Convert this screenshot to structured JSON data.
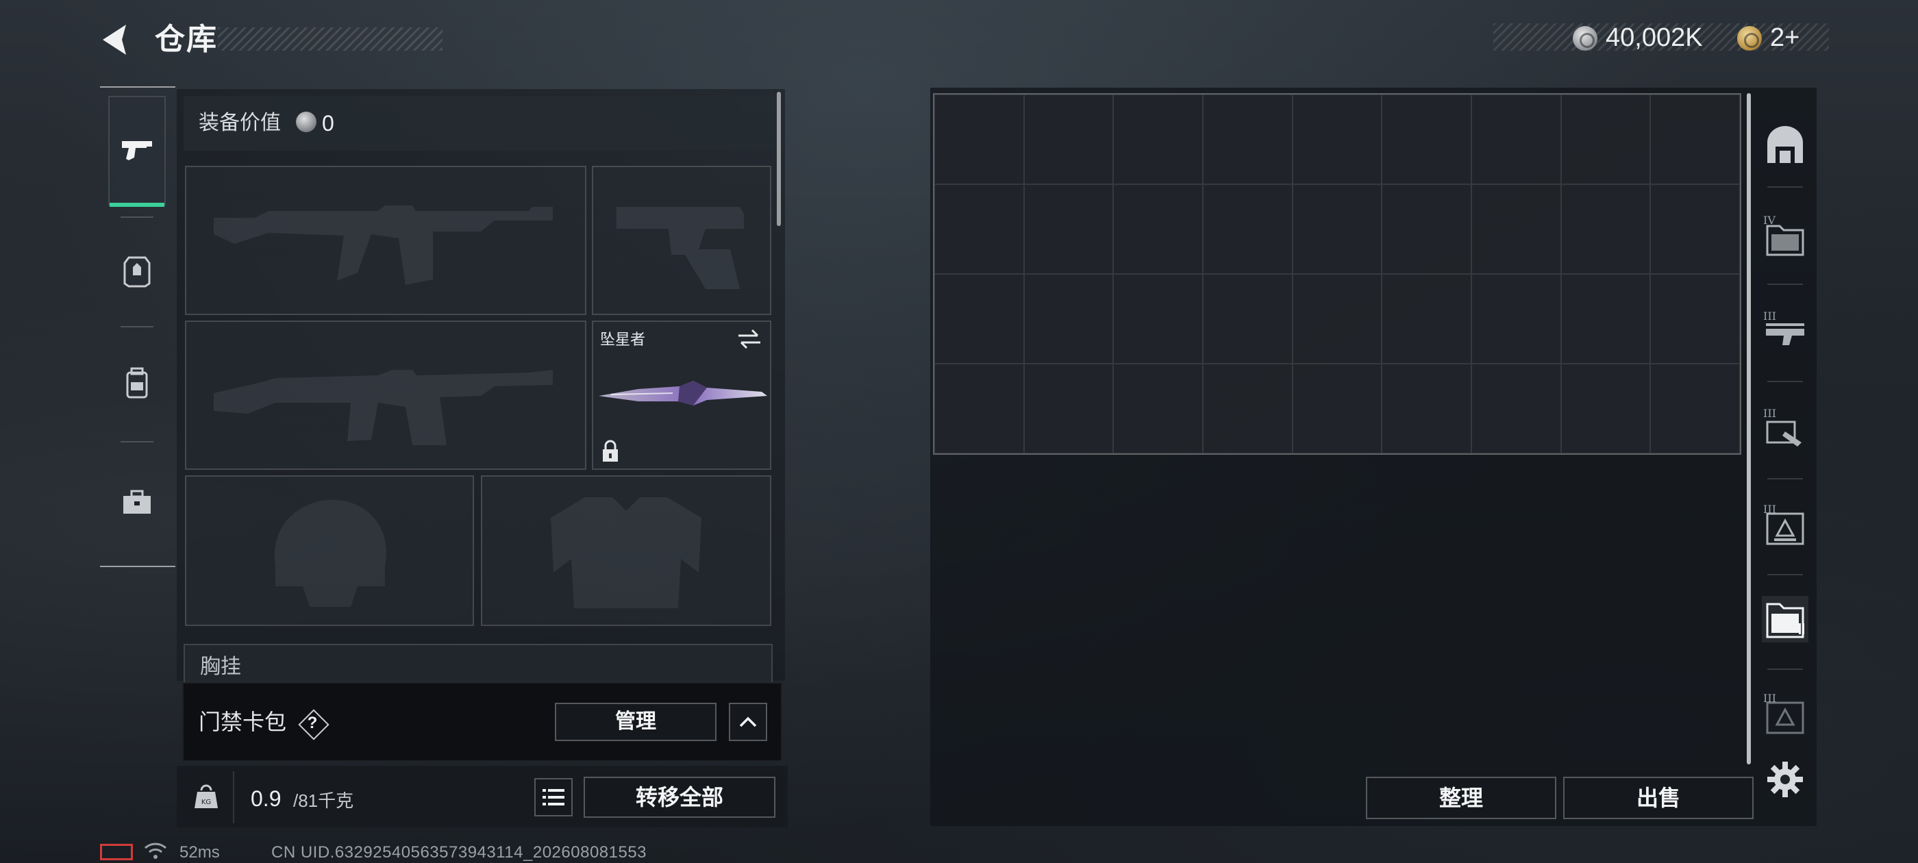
{
  "header": {
    "title": "仓库",
    "currencies": [
      {
        "icon": "silver-coin-icon",
        "value": "40,002K"
      },
      {
        "icon": "gold-coin-icon",
        "value": "2+"
      }
    ]
  },
  "left_rail": {
    "tabs": [
      {
        "icon": "pistol-icon",
        "active": true
      },
      {
        "icon": "armor-icon",
        "active": false
      },
      {
        "icon": "backpack-icon",
        "active": false
      },
      {
        "icon": "toolbox-icon",
        "active": false
      }
    ]
  },
  "loadout": {
    "value_label": "装备价值",
    "value": "0",
    "slots": [
      {
        "kind": "primary-weapon-1",
        "name": "",
        "empty": true
      },
      {
        "kind": "pistol",
        "name": "",
        "empty": true
      },
      {
        "kind": "primary-weapon-2",
        "name": "",
        "empty": true
      },
      {
        "kind": "melee",
        "name": "坠星者",
        "empty": false,
        "locked": true,
        "swappable": true
      },
      {
        "kind": "helmet",
        "name": "",
        "empty": true
      },
      {
        "kind": "body-armor",
        "name": "",
        "empty": true
      }
    ],
    "chest_rig_label": "胸挂"
  },
  "keycard": {
    "label": "门禁卡包",
    "help": "?",
    "manage_label": "管理"
  },
  "weight": {
    "current": "0.9",
    "max": "/81千克",
    "transfer_all_label": "转移全部"
  },
  "status": {
    "ping": "52ms",
    "uid": "CN UID.632925405635739431​14_202608081553"
  },
  "storage": {
    "columns": 9,
    "rows": 4,
    "sort_label": "整理",
    "sell_label": "出售",
    "tabs": [
      {
        "icon": "storage-home-icon",
        "tier": "",
        "active": false
      },
      {
        "icon": "storage-folder-icon",
        "tier": "IV",
        "active": false
      },
      {
        "icon": "storage-gun-icon",
        "tier": "III",
        "active": false
      },
      {
        "icon": "storage-tool-icon",
        "tier": "III",
        "active": false
      },
      {
        "icon": "storage-armor-icon",
        "tier": "III",
        "active": false
      },
      {
        "icon": "storage-folder-icon",
        "tier": "",
        "active": true
      },
      {
        "icon": "storage-armor-icon",
        "tier": "III",
        "active": false
      }
    ]
  },
  "colors": {
    "accent": "#3ccf9a",
    "battery_warning": "#d23b3b"
  }
}
